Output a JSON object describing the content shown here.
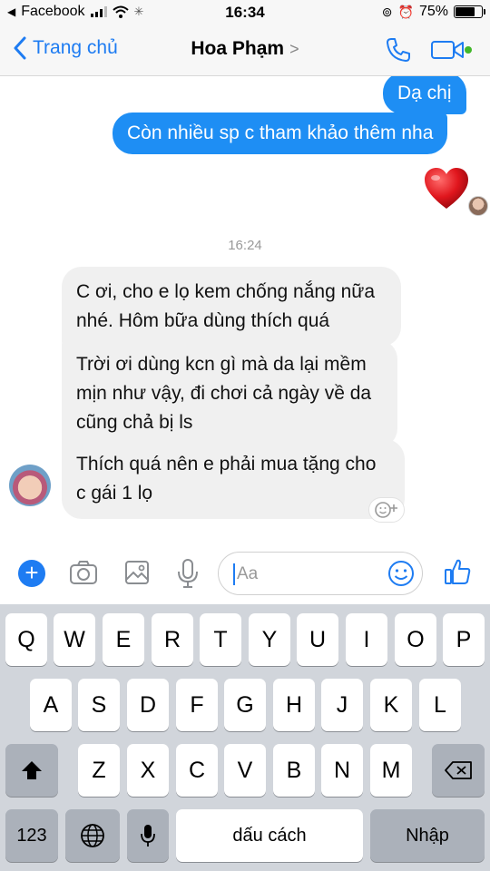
{
  "status_bar": {
    "app": "Facebook",
    "time": "16:34",
    "battery": "75%",
    "battery_level": 0.75
  },
  "nav": {
    "back_label": "Trang chủ",
    "contact_name": "Hoa Phạm",
    "chevron": ">"
  },
  "messages": {
    "sent": [
      "Dạ chị",
      "Còn nhiều sp c tham khảo thêm nha"
    ],
    "timestamp": "16:24",
    "received": [
      {
        "line1": "C ơi, cho e lọ kem chống nắng nữa",
        "line2": "nhé. Hôm bữa dùng thích quá"
      },
      {
        "line1": "Trời ơi dùng kcn gì mà da lại mềm",
        "line2": "mịn như vậy, đi chơi cả ngày về da",
        "line3": "cũng chả bị ls"
      },
      {
        "line1": "Thích quá nên e phải mua tặng cho",
        "line2": "c gái 1 lọ"
      }
    ]
  },
  "composer": {
    "placeholder": "Aa"
  },
  "keyboard": {
    "row1": [
      "Q",
      "W",
      "E",
      "R",
      "T",
      "Y",
      "U",
      "I",
      "O",
      "P"
    ],
    "row2": [
      "A",
      "S",
      "D",
      "F",
      "G",
      "H",
      "J",
      "K",
      "L"
    ],
    "row3": [
      "Z",
      "X",
      "C",
      "V",
      "B",
      "N",
      "M"
    ],
    "numbers_label": "123",
    "space_label": "dấu cách",
    "return_label": "Nhập"
  },
  "icons": [
    "back-chevron-icon",
    "phone-icon",
    "video-call-icon",
    "heart-icon",
    "add-reaction-icon",
    "plus-icon",
    "camera-icon",
    "gallery-icon",
    "microphone-icon",
    "emoji-icon",
    "thumbs-up-icon",
    "shift-icon",
    "delete-icon",
    "globe-icon"
  ],
  "colors": {
    "accent": "#1e7cf2",
    "sent_bubble": "#1e8ef4",
    "received_bubble": "#f0f0f0",
    "online_dot": "#42b72a",
    "heart": "#e0161d"
  }
}
